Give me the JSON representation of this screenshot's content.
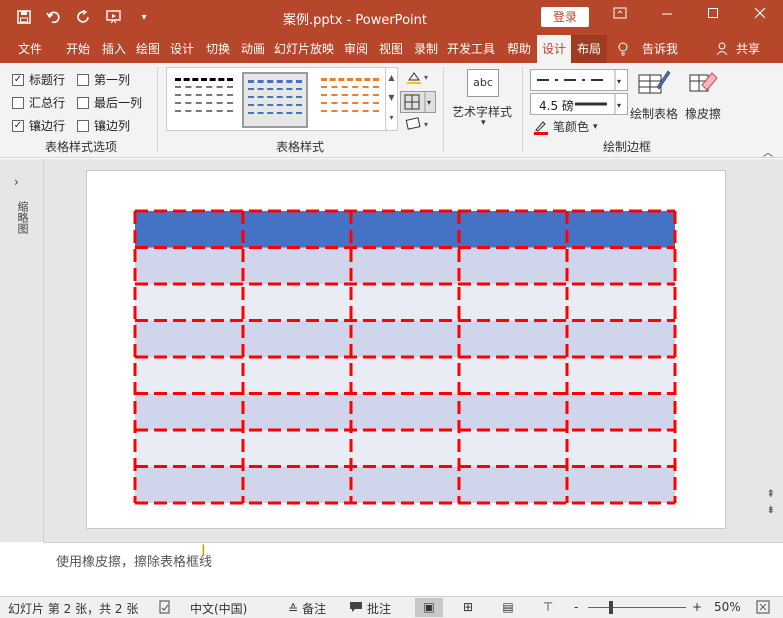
{
  "titlebar": {
    "doc_title": "案例.pptx  -  PowerPoint",
    "login_label": "登录",
    "qat_icons": [
      "save-icon",
      "undo-icon",
      "redo-icon",
      "present-icon",
      "customize-icon"
    ],
    "window_controls": [
      "ribbon-display-icon",
      "minimize-icon",
      "maximize-icon",
      "close-icon"
    ]
  },
  "tabs": {
    "file": "文件",
    "home": "开始",
    "insert": "插入",
    "draw": "绘图",
    "design": "设计",
    "transitions": "切换",
    "animations": "动画",
    "slideshow": "幻灯片放映",
    "review": "审阅",
    "view": "视图",
    "record": "录制",
    "developer": "开发工具",
    "help": "帮助",
    "table_design": "设计",
    "table_layout": "布局",
    "tell_me": "告诉我",
    "share": "共享"
  },
  "ribbon": {
    "style_options": {
      "header_row": "标题行",
      "first_column": "第一列",
      "total_row": "汇总行",
      "last_column": "最后一列",
      "banded_rows": "镶边行",
      "banded_columns": "镶边列",
      "group_label": "表格样式选项",
      "checked": {
        "header_row": true,
        "first_column": false,
        "total_row": false,
        "last_column": false,
        "banded_rows": true,
        "banded_columns": false
      }
    },
    "table_styles": {
      "group_label": "表格样式",
      "swatch_colors": [
        "#000000",
        "#4472c4",
        "#ed7d31"
      ]
    },
    "wordart": {
      "label": "艺术字样式",
      "icon_text": "abc"
    },
    "borders": {
      "pen_weight": "4.5 磅",
      "pen_color": "笔颜色",
      "pen_color_value": "#ff0000",
      "draw_table": "绘制表格",
      "eraser": "橡皮擦",
      "group_label": "绘制边框"
    }
  },
  "thumbpane": {
    "label": "缩略图",
    "expand_icon": "chevron-right-icon"
  },
  "slide_table": {
    "rows": 8,
    "cols": 5,
    "header_color": "#4472c4",
    "band_dark": "#cfd5ea",
    "band_light": "#e9ebf5",
    "border_color": "#ff0000"
  },
  "notes": {
    "text": "使用橡皮擦，擦除表格框线"
  },
  "status": {
    "slide_info": "幻灯片 第 2 张，共 2 张",
    "language": "中文(中国)",
    "notes_label": "备注",
    "comments_label": "批注",
    "zoom_minus": "-",
    "zoom_plus": "+",
    "zoom_level": "50%"
  }
}
